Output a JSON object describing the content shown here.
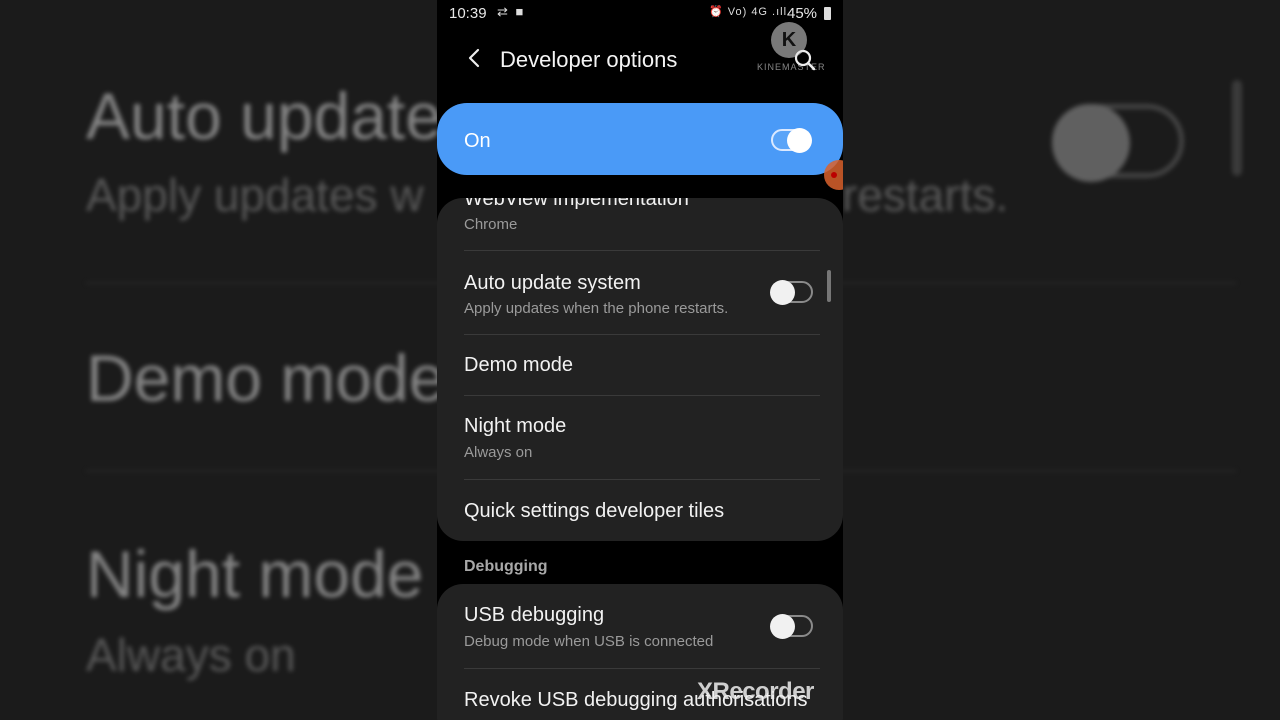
{
  "statusbar": {
    "time": "10:39",
    "left_icons": "⇄ ■",
    "right_icons": "⏰ Vo) 4G .ıll",
    "battery": "45%"
  },
  "header": {
    "title": "Developer options",
    "back_icon": "back-arrow-icon",
    "search_icon": "search-icon"
  },
  "watermarks": {
    "kinemaster_letter": "K",
    "kinemaster_text": "KINEMASTER",
    "xrecorder": "XRecorder"
  },
  "master_switch": {
    "label": "On",
    "checked": true,
    "accent_color": "#4a9af7"
  },
  "card1": {
    "webview": {
      "title": "WebView implementation",
      "value": "Chrome"
    },
    "auto_update": {
      "title": "Auto update system",
      "subtitle": "Apply updates when the phone restarts.",
      "checked": false
    },
    "demo_mode": {
      "title": "Demo mode"
    },
    "night_mode": {
      "title": "Night mode",
      "value": "Always on"
    },
    "quick_tiles": {
      "title": "Quick settings developer tiles"
    }
  },
  "debugging": {
    "header": "Debugging",
    "usb_debugging": {
      "title": "USB debugging",
      "subtitle": "Debug mode when USB is connected",
      "checked": false
    },
    "revoke": {
      "title": "Revoke USB debugging authorisations"
    }
  },
  "background": {
    "line1": "Auto update",
    "line2": "Apply updates w",
    "line2_right": "restarts.",
    "line3": "Demo mode",
    "line4": "Night mode",
    "line5": "Always on"
  }
}
